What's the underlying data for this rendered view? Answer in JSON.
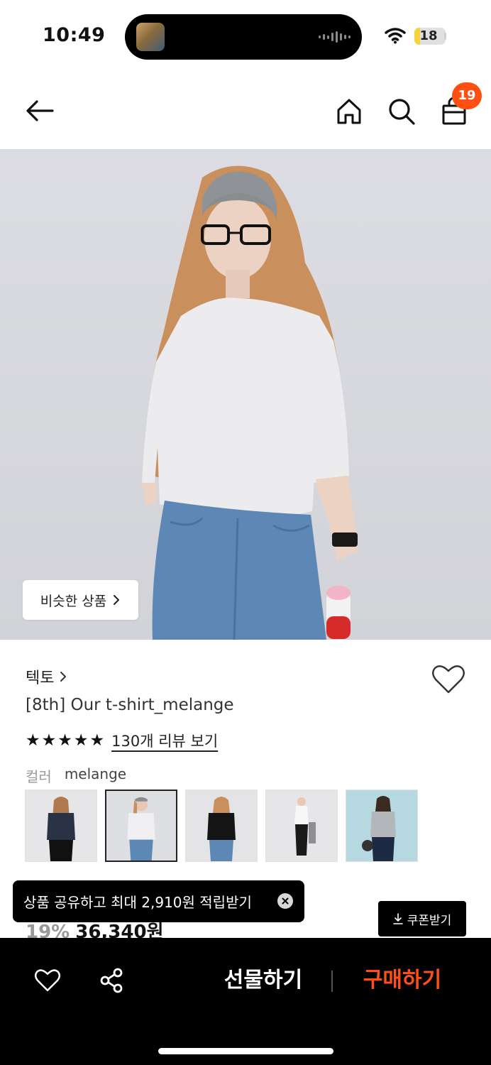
{
  "status_bar": {
    "time": "10:49",
    "battery": "18",
    "battery_level": 0.18,
    "battery_color": "#f7d33b"
  },
  "header": {
    "back_icon": "arrow-left-icon",
    "home_icon": "home-icon",
    "search_icon": "search-icon",
    "cart_icon": "shopping-bag-icon",
    "cart_count": "19",
    "badge_color": "#ff4f12"
  },
  "hero": {
    "similar_button": "비슷한 상품"
  },
  "product": {
    "brand": "텍토",
    "name": "[8th] Our t-shirt_melange",
    "rating": 5,
    "review_link": "130개 리뷰 보기",
    "color_label": "컬러",
    "color_value": "melange",
    "swatches": [
      "navy",
      "melange",
      "black",
      "white",
      "grey"
    ],
    "selected_swatch": "melange",
    "discount": "19%",
    "price": "36,340원"
  },
  "coupon": {
    "label": "쿠폰받기"
  },
  "toast": {
    "message": "상품 공유하고 최대 2,910원 적립받기"
  },
  "bottom_bar": {
    "gift_label": "선물하기",
    "buy_label": "구매하기",
    "buy_color": "#ff4f12"
  }
}
